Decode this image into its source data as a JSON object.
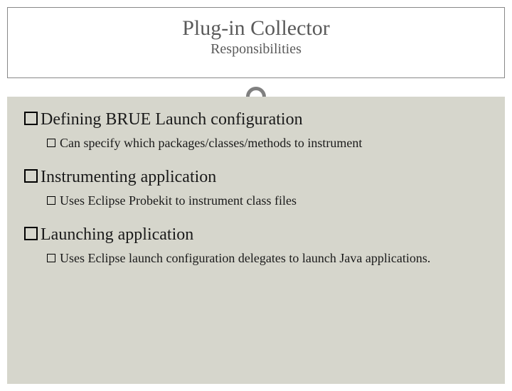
{
  "header": {
    "title": "Plug-in Collector",
    "subtitle": "Responsibilities"
  },
  "items": [
    {
      "heading": "Defining BRUE Launch configuration",
      "sub": "Can specify which packages/classes/methods to instrument"
    },
    {
      "heading": "Instrumenting application",
      "sub": "Uses Eclipse Probekit to instrument class files"
    },
    {
      "heading": "Launching application",
      "sub": "Uses Eclipse launch configuration delegates to launch Java applications."
    }
  ]
}
